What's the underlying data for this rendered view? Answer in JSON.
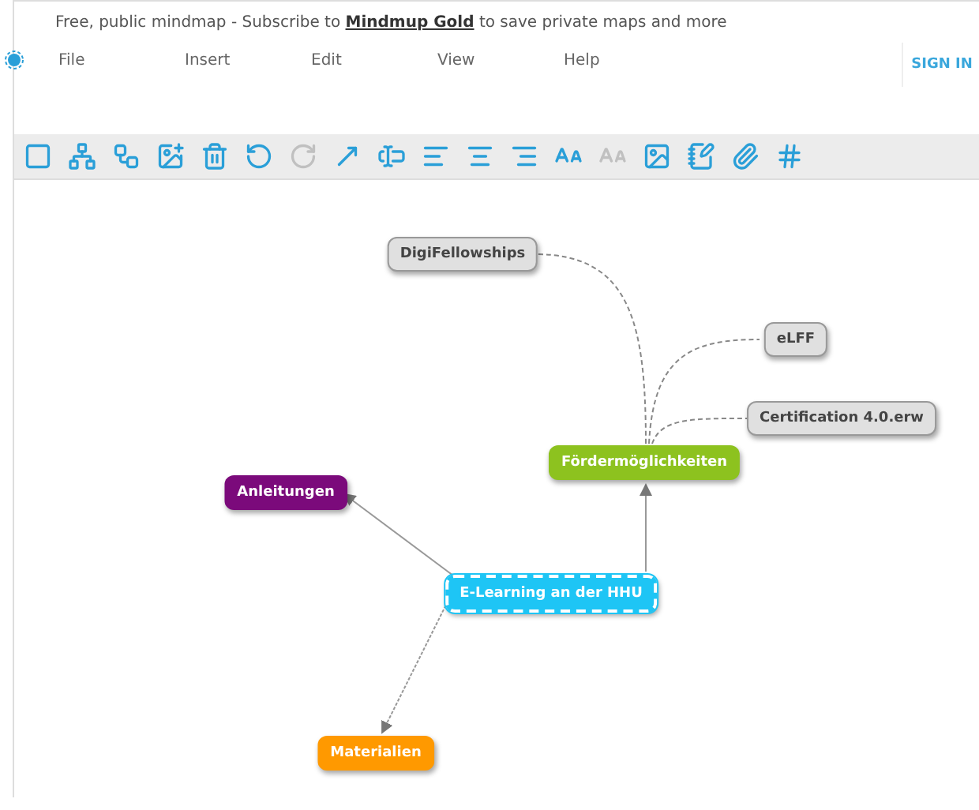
{
  "banner": {
    "before": "Free, public mindmap - Subscribe to ",
    "link": "Mindmup Gold",
    "after": " to save private maps and more"
  },
  "menu": [
    "File",
    "Insert",
    "Edit",
    "View",
    "Help"
  ],
  "sign_in": "SIGN IN",
  "toolbar": [
    {
      "disabled": false
    },
    {
      "disabled": false
    },
    {
      "disabled": false
    },
    {
      "disabled": false
    },
    {
      "disabled": false
    },
    {
      "disabled": false
    },
    {
      "disabled": true
    },
    {
      "disabled": false
    },
    {
      "disabled": false
    },
    {
      "disabled": false
    },
    {
      "disabled": false
    },
    {
      "disabled": false
    },
    {
      "disabled": false
    },
    {
      "disabled": true
    },
    {
      "disabled": false
    },
    {
      "disabled": false
    },
    {
      "disabled": false
    },
    {
      "disabled": false
    }
  ],
  "map": {
    "title": "E-Learning an der HHU",
    "color": "#1ec5f5",
    "selected": true,
    "children": [
      {
        "title": "Fördermöglichkeiten",
        "color": "#8dc21f",
        "selected": false,
        "children": [
          {
            "title": "DigiFellowships",
            "color": "#e0e0e0",
            "selected": false
          },
          {
            "title": "eLFF",
            "color": "#e0e0e0",
            "selected": false
          },
          {
            "title": "Certification 4.0.erw",
            "color": "#e0e0e0",
            "selected": false
          }
        ]
      },
      {
        "title": "Anleitungen",
        "color": "#7b0a7b",
        "selected": false
      },
      {
        "title": "Materialien",
        "color": "#ff9900",
        "selected": false
      }
    ]
  }
}
